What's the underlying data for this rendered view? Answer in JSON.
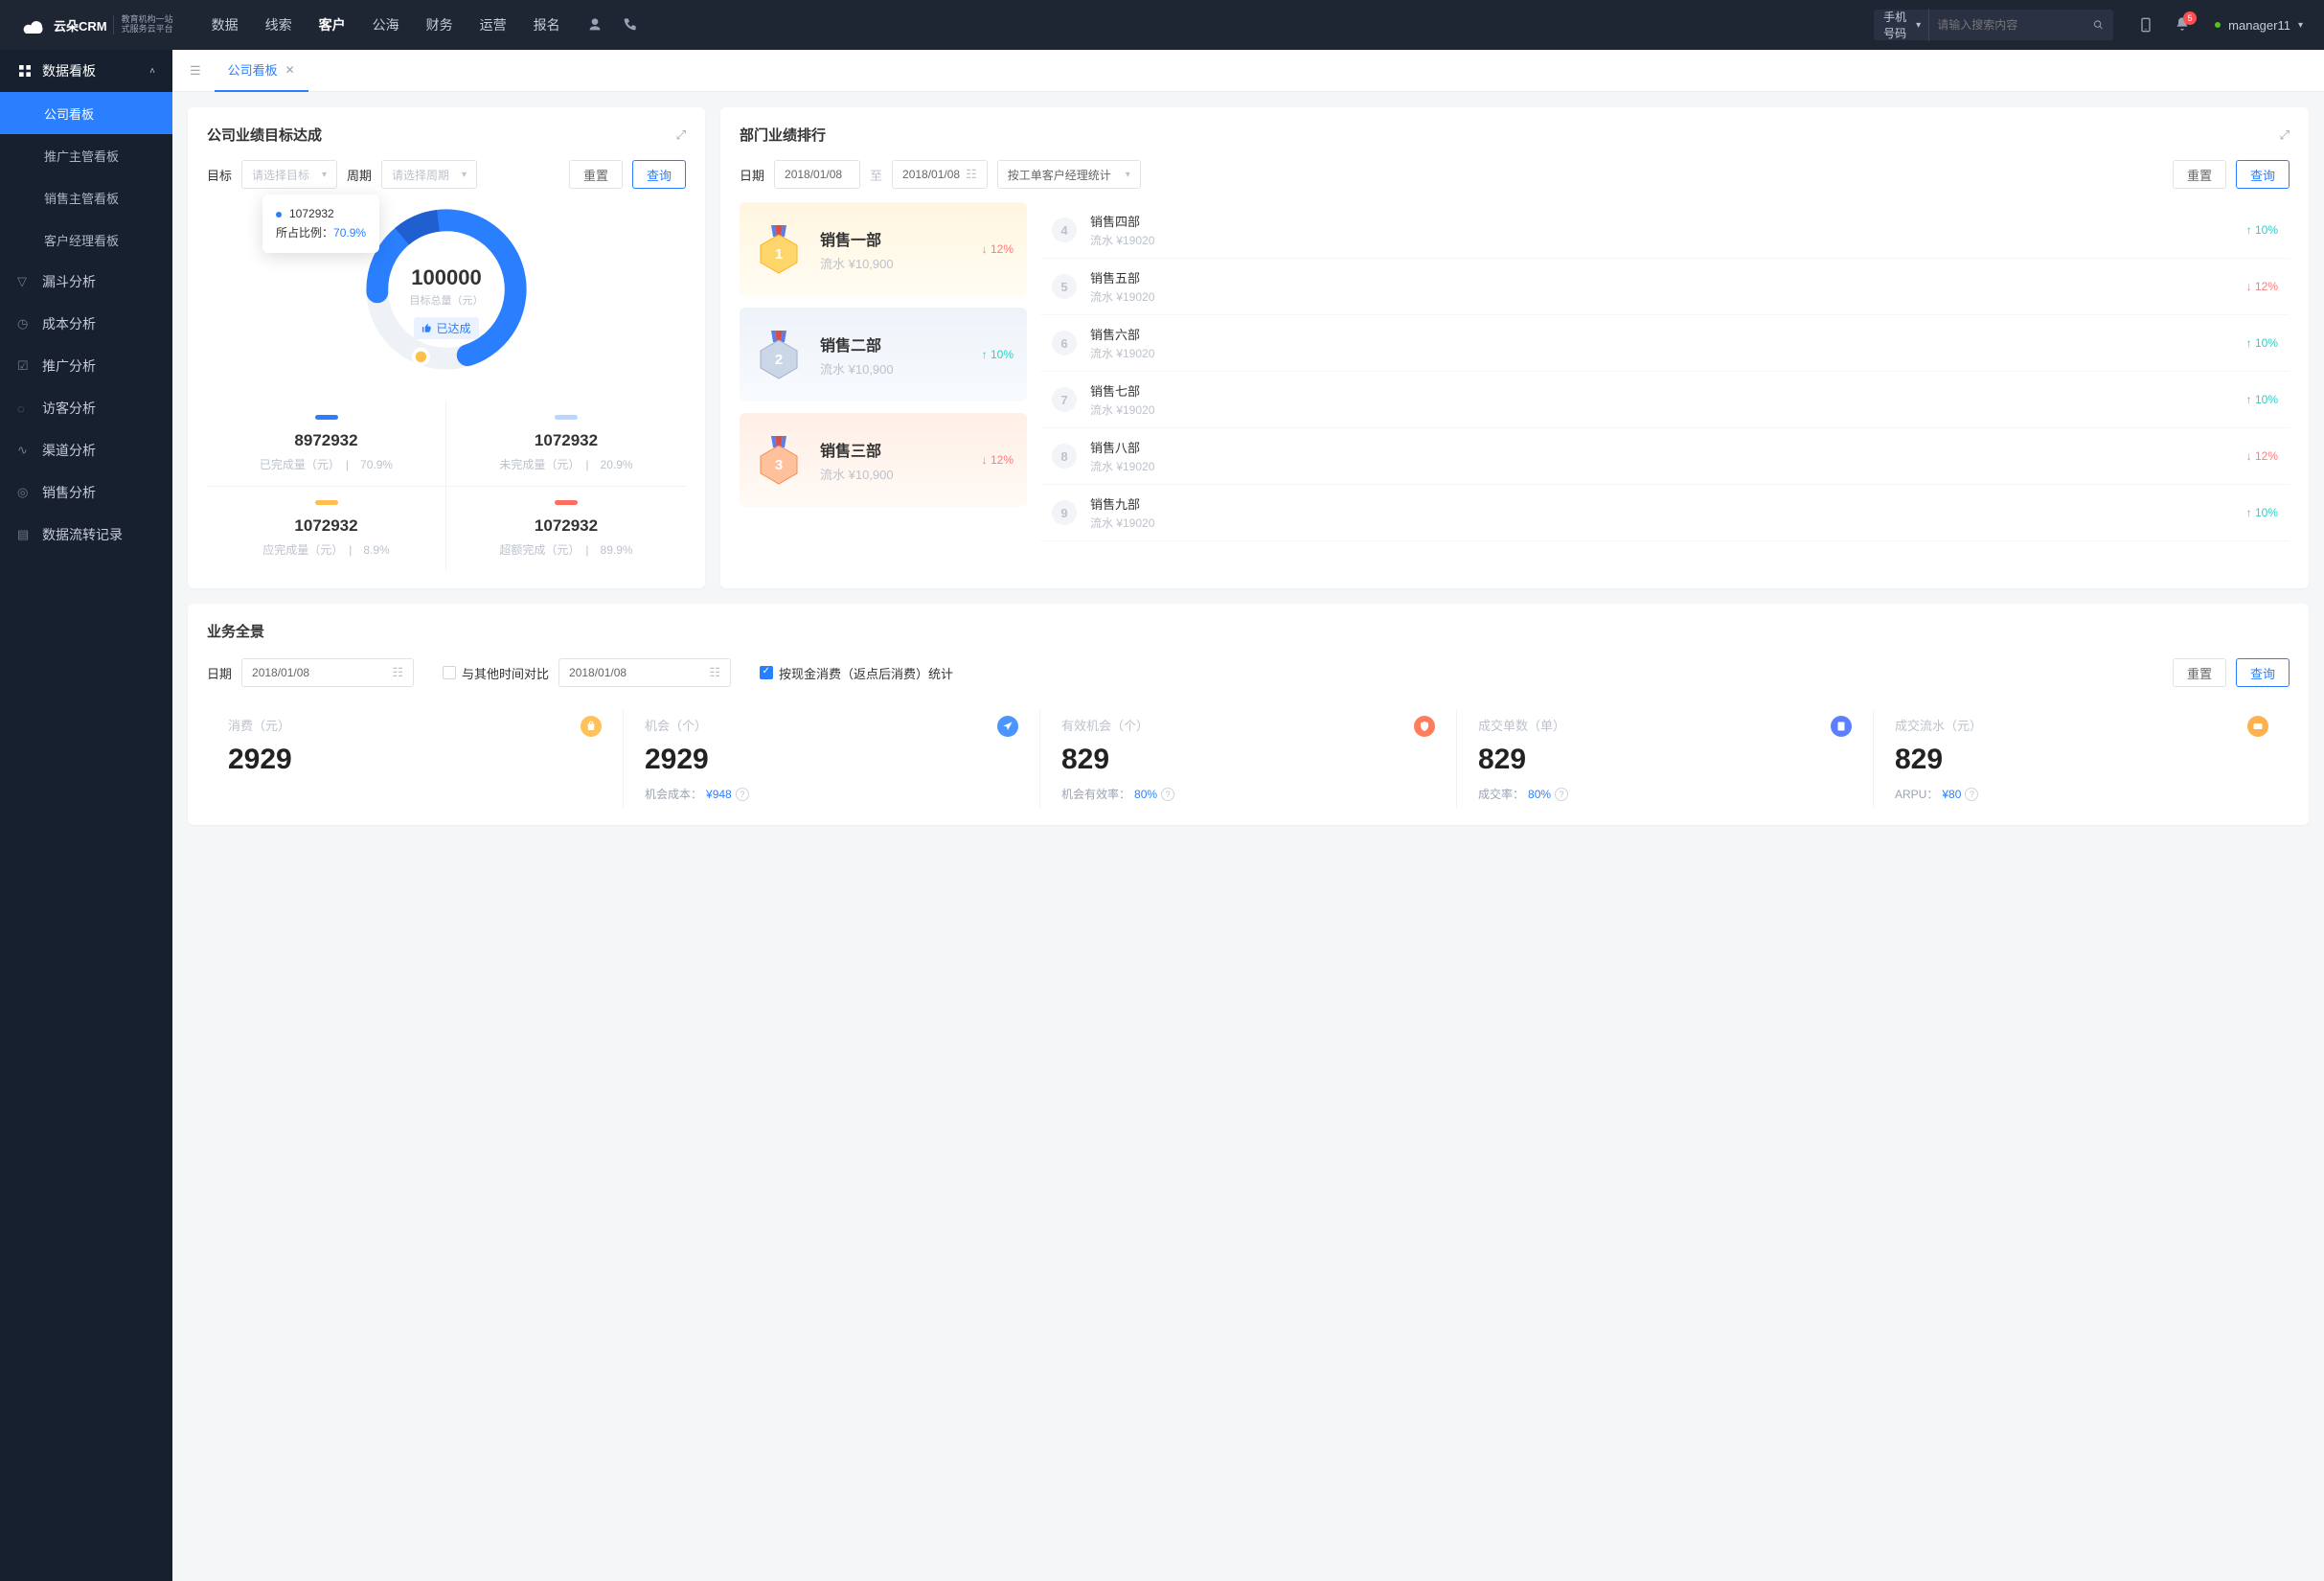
{
  "header": {
    "logo_text": "云朵CRM",
    "logo_sub": "教育机构一站\n式服务云平台",
    "nav": [
      "数据",
      "线索",
      "客户",
      "公海",
      "财务",
      "运营",
      "报名"
    ],
    "nav_active_index": 2,
    "search_select": "手机号码",
    "search_placeholder": "请输入搜索内容",
    "notification_count": "5",
    "user_name": "manager11"
  },
  "sidebar": {
    "parent": "数据看板",
    "children": [
      "公司看板",
      "推广主管看板",
      "销售主管看板",
      "客户经理看板"
    ],
    "active_child_index": 0,
    "others": [
      "漏斗分析",
      "成本分析",
      "推广分析",
      "访客分析",
      "渠道分析",
      "销售分析",
      "数据流转记录"
    ]
  },
  "tab": {
    "label": "公司看板"
  },
  "goal": {
    "title": "公司业绩目标达成",
    "lbl_target": "目标",
    "target_placeholder": "请选择目标",
    "lbl_period": "周期",
    "period_placeholder": "请选择周期",
    "btn_reset": "重置",
    "btn_query": "查询",
    "tooltip_value": "1072932",
    "tooltip_label": "所占比例：",
    "tooltip_pct": "70.9%",
    "total_value": "100000",
    "total_label": "目标总量（元）",
    "status_tag": "已达成",
    "metrics": [
      {
        "color": "#2a7fff",
        "value": "8972932",
        "label": "已完成量（元）",
        "pct": "70.9%"
      },
      {
        "color": "#b9d6ff",
        "value": "1072932",
        "label": "未完成量（元）",
        "pct": "20.9%"
      },
      {
        "color": "#ffbe4d",
        "value": "1072932",
        "label": "应完成量（元）",
        "pct": "8.9%"
      },
      {
        "color": "#ff6b5c",
        "value": "1072932",
        "label": "超额完成（元）",
        "pct": "89.9%"
      }
    ]
  },
  "rank": {
    "title": "部门业绩排行",
    "lbl_date": "日期",
    "date1": "2018/01/08",
    "to": "至",
    "date2": "2018/01/08",
    "stat_select": "按工单客户经理统计",
    "btn_reset": "重置",
    "btn_query": "查询",
    "top": [
      {
        "rank": "1",
        "name": "销售一部",
        "sub": "流水 ¥10,900",
        "change": "12%",
        "dir": "down"
      },
      {
        "rank": "2",
        "name": "销售二部",
        "sub": "流水 ¥10,900",
        "change": "10%",
        "dir": "up"
      },
      {
        "rank": "3",
        "name": "销售三部",
        "sub": "流水 ¥10,900",
        "change": "12%",
        "dir": "down"
      }
    ],
    "rest": [
      {
        "rank": "4",
        "name": "销售四部",
        "sub": "流水 ¥19020",
        "change": "10%",
        "dir": "up"
      },
      {
        "rank": "5",
        "name": "销售五部",
        "sub": "流水 ¥19020",
        "change": "12%",
        "dir": "down"
      },
      {
        "rank": "6",
        "name": "销售六部",
        "sub": "流水 ¥19020",
        "change": "10%",
        "dir": "up"
      },
      {
        "rank": "7",
        "name": "销售七部",
        "sub": "流水 ¥19020",
        "change": "10%",
        "dir": "up"
      },
      {
        "rank": "8",
        "name": "销售八部",
        "sub": "流水 ¥19020",
        "change": "12%",
        "dir": "down"
      },
      {
        "rank": "9",
        "name": "销售九部",
        "sub": "流水 ¥19020",
        "change": "10%",
        "dir": "up"
      }
    ]
  },
  "overview": {
    "title": "业务全景",
    "lbl_date": "日期",
    "date": "2018/01/08",
    "compare_label": "与其他时间对比",
    "date2": "2018/01/08",
    "checkbox_label": "按现金消费（返点后消费）统计",
    "btn_reset": "重置",
    "btn_query": "查询",
    "kpis": [
      {
        "label": "消费（元）",
        "icon": "bag",
        "color": "#ffc259",
        "value": "2929",
        "sub_key": "",
        "sub_val": ""
      },
      {
        "label": "机会（个）",
        "icon": "plane",
        "color": "#4c95ff",
        "value": "2929",
        "sub_key": "机会成本：",
        "sub_val": "¥948"
      },
      {
        "label": "有效机会（个）",
        "icon": "shield",
        "color": "#ff7d5a",
        "value": "829",
        "sub_key": "机会有效率：",
        "sub_val": "80%"
      },
      {
        "label": "成交单数（单）",
        "icon": "doc",
        "color": "#5b7fff",
        "value": "829",
        "sub_key": "成交率：",
        "sub_val": "80%"
      },
      {
        "label": "成交流水（元）",
        "icon": "card",
        "color": "#ffb14d",
        "value": "829",
        "sub_key": "ARPU：",
        "sub_val": "¥80"
      }
    ]
  },
  "chart_data": {
    "type": "pie",
    "title": "公司业绩目标达成",
    "total": 100000,
    "total_unit": "元",
    "series": [
      {
        "name": "已完成量",
        "value": 8972932,
        "pct": 70.9,
        "color": "#2a7fff"
      },
      {
        "name": "未完成量",
        "value": 1072932,
        "pct": 20.9,
        "color": "#b9d6ff"
      },
      {
        "name": "应完成量",
        "value": 1072932,
        "pct": 8.9,
        "color": "#ffbe4d"
      },
      {
        "name": "超额完成",
        "value": 1072932,
        "pct": 89.9,
        "color": "#ff6b5c"
      }
    ]
  }
}
